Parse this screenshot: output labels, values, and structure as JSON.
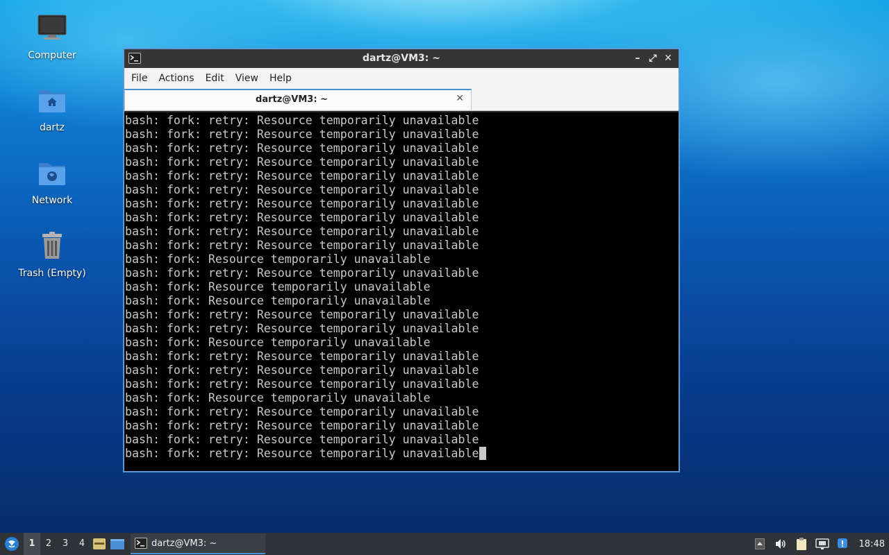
{
  "desktop": {
    "icons": [
      {
        "label": "Computer"
      },
      {
        "label": "dartz"
      },
      {
        "label": "Network"
      },
      {
        "label": "Trash (Empty)"
      }
    ]
  },
  "window": {
    "title": "dartz@VM3: ~",
    "controls": {
      "minimize": "–",
      "maximize": "⤢",
      "close": "✕"
    },
    "menu": [
      "File",
      "Actions",
      "Edit",
      "View",
      "Help"
    ],
    "tab": {
      "label": "dartz@VM3: ~",
      "close": "✕"
    },
    "terminal_lines": [
      "bash: fork: retry: Resource temporarily unavailable",
      "bash: fork: retry: Resource temporarily unavailable",
      "bash: fork: retry: Resource temporarily unavailable",
      "bash: fork: retry: Resource temporarily unavailable",
      "bash: fork: retry: Resource temporarily unavailable",
      "bash: fork: retry: Resource temporarily unavailable",
      "bash: fork: retry: Resource temporarily unavailable",
      "bash: fork: retry: Resource temporarily unavailable",
      "bash: fork: retry: Resource temporarily unavailable",
      "bash: fork: retry: Resource temporarily unavailable",
      "bash: fork: Resource temporarily unavailable",
      "bash: fork: retry: Resource temporarily unavailable",
      "bash: fork: Resource temporarily unavailable",
      "bash: fork: Resource temporarily unavailable",
      "bash: fork: retry: Resource temporarily unavailable",
      "bash: fork: retry: Resource temporarily unavailable",
      "bash: fork: Resource temporarily unavailable",
      "bash: fork: retry: Resource temporarily unavailable",
      "bash: fork: retry: Resource temporarily unavailable",
      "bash: fork: retry: Resource temporarily unavailable",
      "bash: fork: Resource temporarily unavailable",
      "bash: fork: retry: Resource temporarily unavailable",
      "bash: fork: retry: Resource temporarily unavailable",
      "bash: fork: retry: Resource temporarily unavailable",
      "bash: fork: retry: Resource temporarily unavailable"
    ]
  },
  "taskbar": {
    "workspaces": [
      "1",
      "2",
      "3",
      "4"
    ],
    "active_workspace": "1",
    "task_label": "dartz@VM3: ~",
    "clock": "18:48"
  },
  "icons": {
    "start": "lxqt-menu-icon",
    "show_desktop": "show-desktop-icon",
    "file_manager": "file-manager-icon",
    "terminal": "terminal-icon",
    "tray": [
      "tray-up-arrow-icon",
      "volume-icon",
      "clipboard-icon",
      "network-icon",
      "update-notifier-icon"
    ]
  },
  "colors": {
    "accent": "#4a90d9",
    "terminal_bg": "#000000",
    "terminal_fg": "#c8c8c8",
    "titlebar_bg": "#353535",
    "taskbar_bg": "#2f3236"
  }
}
